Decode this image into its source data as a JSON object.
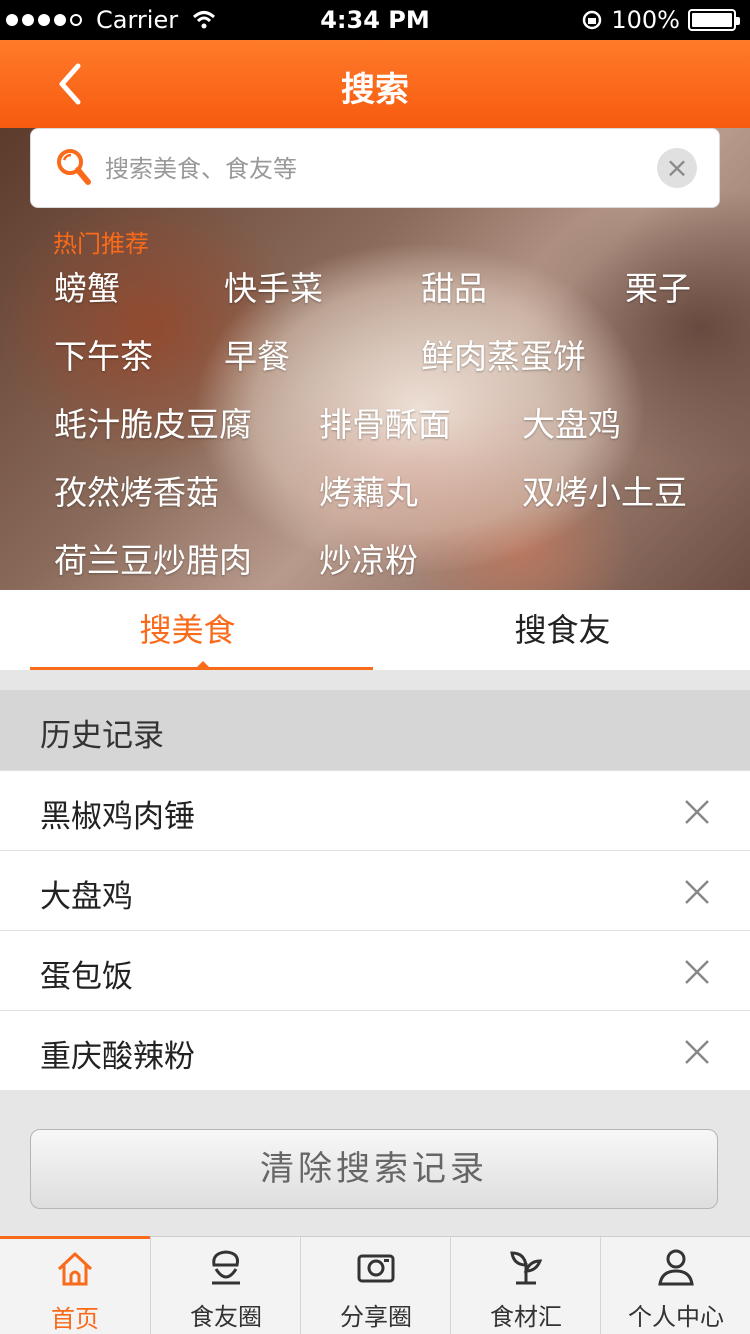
{
  "status_bar": {
    "carrier": "Carrier",
    "time": "4:34 PM",
    "battery": "100%"
  },
  "nav": {
    "title": "搜索"
  },
  "search": {
    "placeholder": "搜索美食、食友等"
  },
  "hot": {
    "label": "热门推荐",
    "words": [
      "螃蟹",
      "快手菜",
      "甜品",
      "栗子",
      "下午茶",
      "早餐",
      "鲜肉蒸蛋饼",
      "蚝汁脆皮豆腐",
      "排骨酥面",
      "大盘鸡",
      "孜然烤香菇",
      "烤藕丸",
      "双烤小土豆",
      "荷兰豆炒腊肉",
      "炒凉粉"
    ]
  },
  "tabs": {
    "food": "搜美食",
    "friends": "搜食友"
  },
  "history": {
    "title": "历史记录",
    "items": [
      "黑椒鸡肉锤",
      "大盘鸡",
      "蛋包饭",
      "重庆酸辣粉"
    ],
    "clear_label": "清除搜索记录"
  },
  "tab_bar": {
    "items": [
      "首页",
      "食友圈",
      "分享圈",
      "食材汇",
      "个人中心"
    ],
    "active": "首页"
  },
  "colors": {
    "accent": "#f96a1a",
    "nav": "#f75b0f"
  }
}
